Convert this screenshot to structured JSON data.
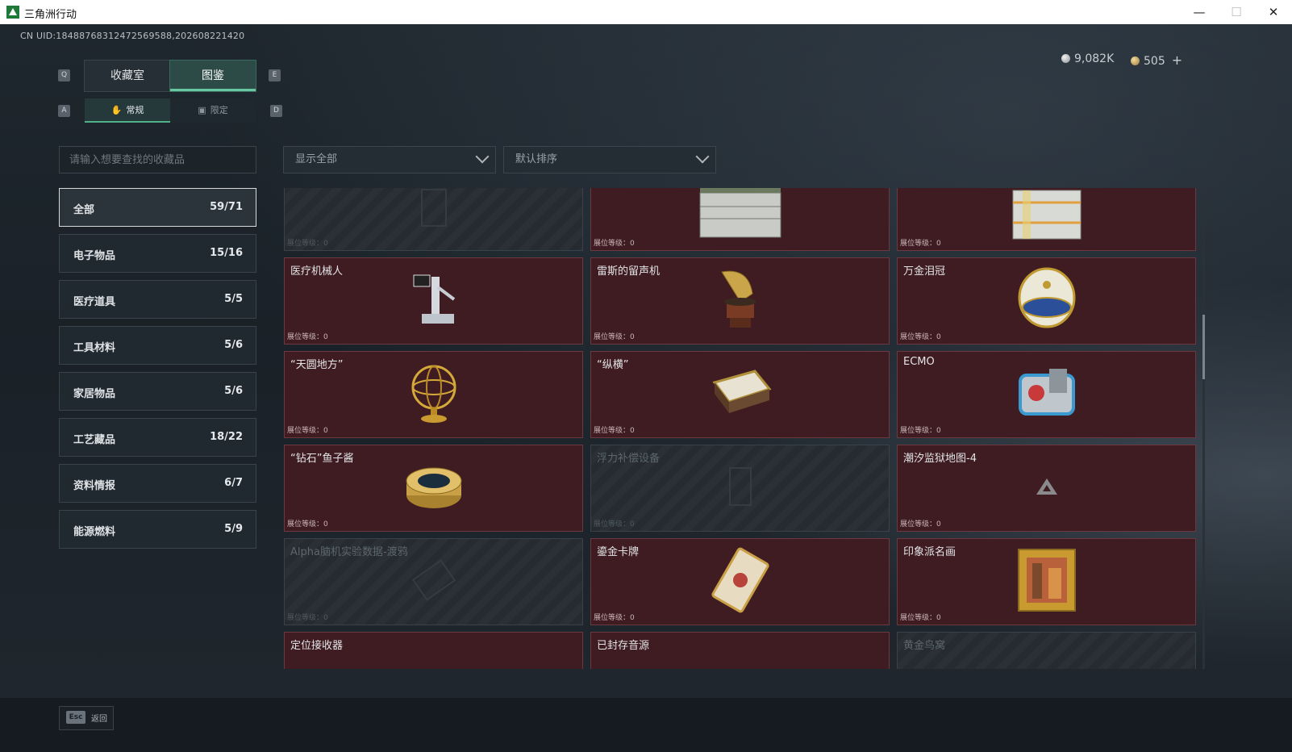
{
  "window": {
    "title": "三角洲行动",
    "minimize": "—",
    "maximize": "☐",
    "close": "✕"
  },
  "header": {
    "uid": "CN UID:18488768312472569588,202608221420",
    "currency_silver": "9,082K",
    "currency_gold": "505",
    "plus": "+"
  },
  "tabs_main": {
    "left_key": "Q",
    "right_key": "E",
    "items": [
      "收藏室",
      "图鉴"
    ],
    "active": 1
  },
  "tabs_sub": {
    "left_key": "A",
    "right_key": "D",
    "items": [
      "常规",
      "限定"
    ],
    "active": 0
  },
  "search": {
    "placeholder": "请输入想要查找的收藏品",
    "value": ""
  },
  "filters": {
    "display": "显示全部",
    "sort": "默认排序"
  },
  "categories": [
    {
      "label": "全部",
      "count": "59/71"
    },
    {
      "label": "电子物品",
      "count": "15/16"
    },
    {
      "label": "医疗道具",
      "count": "5/5"
    },
    {
      "label": "工具材料",
      "count": "5/6"
    },
    {
      "label": "家居物品",
      "count": "5/6"
    },
    {
      "label": "工艺藏品",
      "count": "18/22"
    },
    {
      "label": "资料情报",
      "count": "6/7"
    },
    {
      "label": "能源燃料",
      "count": "5/9"
    }
  ],
  "level_label": "展位等级：0",
  "items": [
    {
      "name": "",
      "locked": true,
      "icon": "crate-icon"
    },
    {
      "name": "",
      "locked": false,
      "icon": "server-box-icon"
    },
    {
      "name": "",
      "locked": false,
      "icon": "battery-pack-icon"
    },
    {
      "name": "医疗机械人",
      "locked": false,
      "icon": "medical-robot-icon"
    },
    {
      "name": "雷斯的留声机",
      "locked": false,
      "icon": "gramophone-icon"
    },
    {
      "name": "万金泪冠",
      "locked": false,
      "icon": "jeweled-egg-icon"
    },
    {
      "name": "“天圆地方”",
      "locked": false,
      "icon": "armillary-sphere-icon"
    },
    {
      "name": "“纵横”",
      "locked": false,
      "icon": "chess-box-icon"
    },
    {
      "name": "ECMO",
      "locked": false,
      "icon": "ecmo-machine-icon"
    },
    {
      "name": "“钻石”鱼子酱",
      "locked": false,
      "icon": "caviar-tin-icon"
    },
    {
      "name": "浮力补偿设备",
      "locked": true,
      "icon": "buoyancy-device-icon"
    },
    {
      "name": "潮汐监狱地图-4",
      "locked": false,
      "icon": "delta-logo-icon"
    },
    {
      "name": "Alpha脑机实验数据-渡鸦",
      "locked": true,
      "icon": "data-drive-icon"
    },
    {
      "name": "鎏金卡牌",
      "locked": false,
      "icon": "gilded-card-icon"
    },
    {
      "name": "印象派名画",
      "locked": false,
      "icon": "painting-icon"
    },
    {
      "name": "定位接收器",
      "locked": false,
      "icon": "receiver-icon"
    },
    {
      "name": "已封存音源",
      "locked": false,
      "icon": "tape-reels-icon"
    },
    {
      "name": "黄金鸟窝",
      "locked": true,
      "icon": "nest-icon"
    }
  ],
  "footer": {
    "esc_key": "Esc",
    "back_label": "返回"
  },
  "colors": {
    "card_owned": "#3f1c22",
    "accent_green": "#67c7a0",
    "locked_stripe": "#252b31"
  }
}
